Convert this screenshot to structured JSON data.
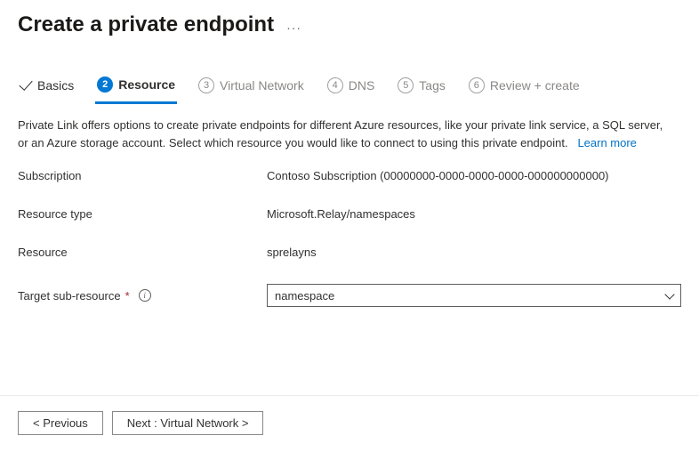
{
  "header": {
    "title": "Create a private endpoint"
  },
  "tabs": {
    "basics": "Basics",
    "resource_num": "2",
    "resource": "Resource",
    "vnet_num": "3",
    "vnet": "Virtual Network",
    "dns_num": "4",
    "dns": "DNS",
    "tags_num": "5",
    "tags": "Tags",
    "review_num": "6",
    "review": "Review + create"
  },
  "description": {
    "text": "Private Link offers options to create private endpoints for different Azure resources, like your private link service, a SQL server, or an Azure storage account. Select which resource you would like to connect to using this private endpoint.",
    "learn_more": "Learn more"
  },
  "form": {
    "subscription_label": "Subscription",
    "subscription_value": "Contoso Subscription (00000000-0000-0000-0000-000000000000)",
    "resource_type_label": "Resource type",
    "resource_type_value": "Microsoft.Relay/namespaces",
    "resource_label": "Resource",
    "resource_value": "sprelayns",
    "target_sub_label": "Target sub-resource",
    "target_sub_value": "namespace"
  },
  "footer": {
    "previous": "< Previous",
    "next": "Next : Virtual Network >"
  }
}
